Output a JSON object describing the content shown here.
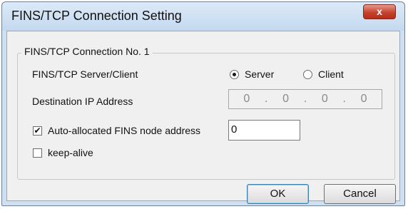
{
  "window": {
    "title": "FINS/TCP Connection Setting",
    "close_label": "x"
  },
  "group": {
    "legend": "FINS/TCP Connection No. 1",
    "server_client_label": "FINS/TCP Server/Client",
    "options": [
      {
        "label": "Server",
        "selected": true
      },
      {
        "label": "Client",
        "selected": false
      }
    ],
    "dest_ip_label": "Destination IP Address",
    "ip_octets": [
      "0",
      "0",
      "0",
      "0"
    ],
    "ip_separator": ".",
    "auto_alloc_label": "Auto-allocated FINS node address",
    "auto_alloc_checked": true,
    "auto_alloc_mark": "✔",
    "node_address_value": "0",
    "keep_alive_label": "keep-alive",
    "keep_alive_checked": false
  },
  "buttons": {
    "ok": "OK",
    "cancel": "Cancel"
  }
}
